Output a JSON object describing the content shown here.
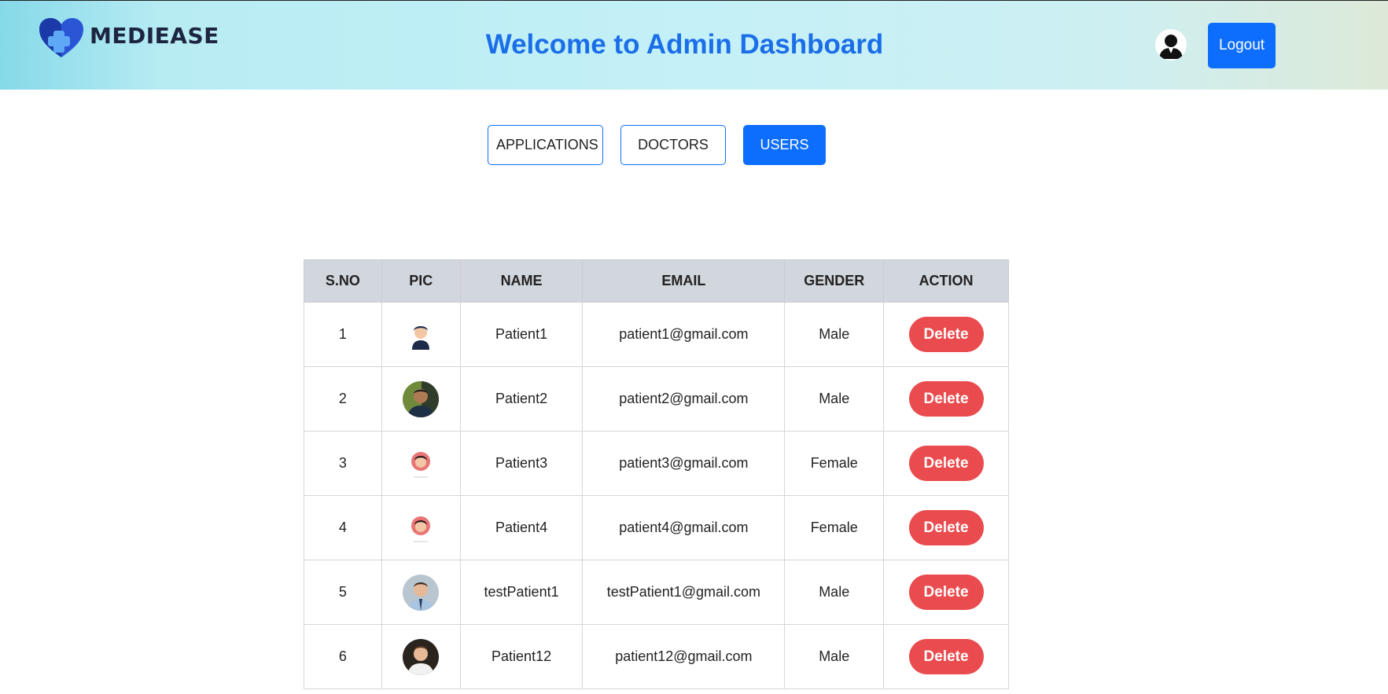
{
  "header": {
    "brand": "MEDIEASE",
    "title": "Welcome to Admin Dashboard",
    "logout_label": "Logout"
  },
  "tabs": [
    {
      "label": "APPLICATIONS",
      "active": false
    },
    {
      "label": "DOCTORS",
      "active": false
    },
    {
      "label": "USERS",
      "active": true
    }
  ],
  "table": {
    "columns": [
      "S.NO",
      "PIC",
      "NAME",
      "EMAIL",
      "GENDER",
      "ACTION"
    ],
    "rows": [
      {
        "sno": "1",
        "name": "Patient1",
        "email": "patient1@gmail.com",
        "gender": "Male",
        "action": "Delete",
        "pic": "cartoon-man-avatar"
      },
      {
        "sno": "2",
        "name": "Patient2",
        "email": "patient2@gmail.com",
        "gender": "Male",
        "action": "Delete",
        "pic": "man-photo-avatar"
      },
      {
        "sno": "3",
        "name": "Patient3",
        "email": "patient3@gmail.com",
        "gender": "Female",
        "action": "Delete",
        "pic": "cartoon-woman-avatar"
      },
      {
        "sno": "4",
        "name": "Patient4",
        "email": "patient4@gmail.com",
        "gender": "Female",
        "action": "Delete",
        "pic": "cartoon-woman-avatar"
      },
      {
        "sno": "5",
        "name": "testPatient1",
        "email": "testPatient1@gmail.com",
        "gender": "Male",
        "action": "Delete",
        "pic": "man-photo-avatar"
      },
      {
        "sno": "6",
        "name": "Patient12",
        "email": "patient12@gmail.com",
        "gender": "Male",
        "action": "Delete",
        "pic": "man-photo-avatar"
      }
    ]
  },
  "colors": {
    "primary": "#0d6efd",
    "title": "#1a6ee8",
    "delete": "#e94b4e",
    "table_header": "#d2d6dd"
  }
}
